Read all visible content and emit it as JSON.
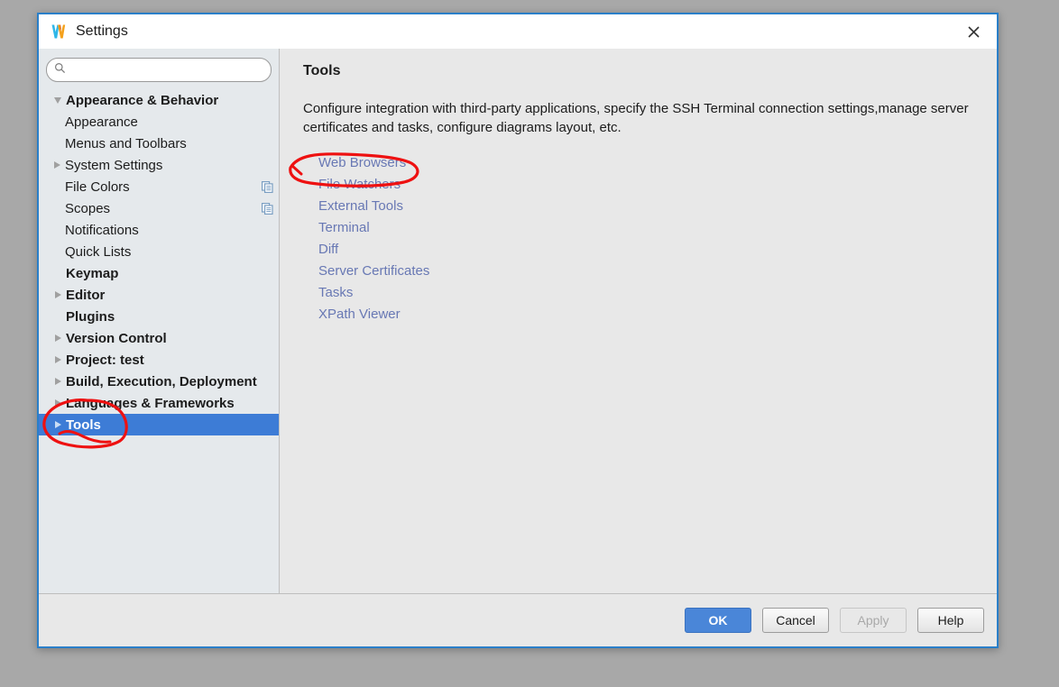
{
  "window": {
    "title": "Settings",
    "app_icon": "webstorm-logo-icon",
    "close_icon": "close-icon",
    "border_color": "#2a7fc9"
  },
  "sidebar": {
    "search": {
      "icon": "search-icon",
      "value": "",
      "placeholder": ""
    },
    "items": [
      {
        "label": "Appearance & Behavior",
        "level": 0,
        "bold": true,
        "twisty": "down",
        "selected": false,
        "icon": ""
      },
      {
        "label": "Appearance",
        "level": 1,
        "bold": false,
        "twisty": "none",
        "selected": false,
        "icon": ""
      },
      {
        "label": "Menus and Toolbars",
        "level": 1,
        "bold": false,
        "twisty": "none",
        "selected": false,
        "icon": ""
      },
      {
        "label": "System Settings",
        "level": 1,
        "bold": false,
        "twisty": "right",
        "selected": false,
        "icon": ""
      },
      {
        "label": "File Colors",
        "level": 1,
        "bold": false,
        "twisty": "none",
        "selected": false,
        "icon": "copy-scope-icon"
      },
      {
        "label": "Scopes",
        "level": 1,
        "bold": false,
        "twisty": "none",
        "selected": false,
        "icon": "copy-scope-icon"
      },
      {
        "label": "Notifications",
        "level": 1,
        "bold": false,
        "twisty": "none",
        "selected": false,
        "icon": ""
      },
      {
        "label": "Quick Lists",
        "level": 1,
        "bold": false,
        "twisty": "none",
        "selected": false,
        "icon": ""
      },
      {
        "label": "Keymap",
        "level": 0,
        "bold": true,
        "twisty": "none",
        "selected": false,
        "icon": ""
      },
      {
        "label": "Editor",
        "level": 0,
        "bold": true,
        "twisty": "right",
        "selected": false,
        "icon": ""
      },
      {
        "label": "Plugins",
        "level": 0,
        "bold": true,
        "twisty": "none",
        "selected": false,
        "icon": ""
      },
      {
        "label": "Version Control",
        "level": 0,
        "bold": true,
        "twisty": "right",
        "selected": false,
        "icon": ""
      },
      {
        "label": "Project: test",
        "level": 0,
        "bold": true,
        "twisty": "right",
        "selected": false,
        "icon": ""
      },
      {
        "label": "Build, Execution, Deployment",
        "level": 0,
        "bold": true,
        "twisty": "right",
        "selected": false,
        "icon": ""
      },
      {
        "label": "Languages & Frameworks",
        "level": 0,
        "bold": true,
        "twisty": "right",
        "selected": false,
        "icon": ""
      },
      {
        "label": "Tools",
        "level": 0,
        "bold": true,
        "twisty": "right",
        "selected": true,
        "icon": ""
      }
    ],
    "selection_color": "#3d7cd6"
  },
  "content": {
    "title": "Tools",
    "description": "Configure integration with third-party applications, specify the SSH Terminal connection settings,manage server certificates and tasks, configure diagrams layout, etc.",
    "link_color": "#6878b4",
    "links": [
      "Web Browsers",
      "File Watchers",
      "External Tools",
      "Terminal",
      "Diff",
      "Server Certificates",
      "Tasks",
      "XPath Viewer"
    ]
  },
  "footer": {
    "ok_label": "OK",
    "cancel_label": "Cancel",
    "apply_label": "Apply",
    "apply_disabled": true,
    "help_label": "Help",
    "primary_color": "#4a86d8"
  },
  "annotations": {
    "color": "#ee1111",
    "marks": [
      {
        "name": "file-watchers-highlight",
        "target": "File Watchers"
      },
      {
        "name": "tools-highlight",
        "target": "Tools"
      }
    ]
  }
}
